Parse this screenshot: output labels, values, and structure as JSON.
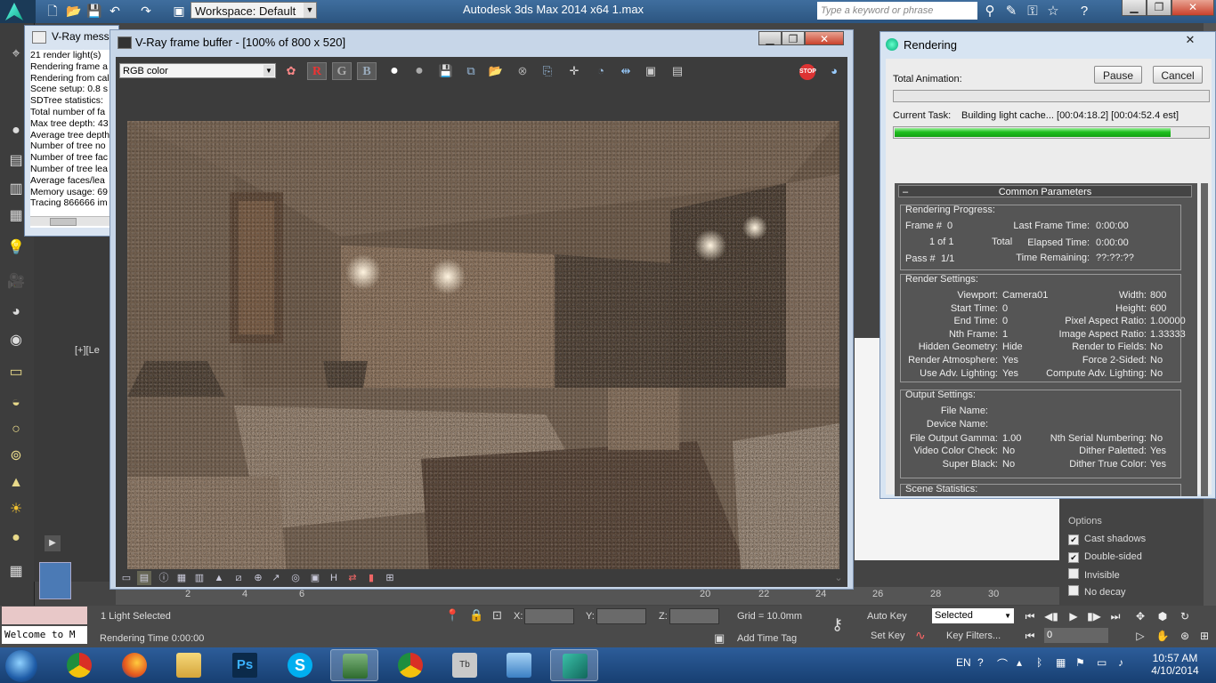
{
  "topbar": {
    "workspace": "Workspace: Default",
    "app_title": "Autodesk 3ds Max  2014 x64      1.max",
    "search_placeholder": "Type a keyword or phrase"
  },
  "vray_messages": {
    "title": "V-Ray messa",
    "lines": [
      "21 render light(s)",
      "Rendering frame a",
      "Rendering from cal",
      "Scene setup: 0.8 s",
      "SDTree statistics:",
      "Total number of fa",
      "Max tree depth: 43",
      "Average tree depth",
      "Number of tree no",
      "Number of tree fac",
      "Number of tree lea",
      "Average faces/lea",
      "Memory usage: 69",
      "Tracing 866666 im"
    ]
  },
  "vfb": {
    "title": "V-Ray frame buffer - [100% of 800 x 520]",
    "channel": "RGB color",
    "r": "R",
    "g": "G",
    "b": "B"
  },
  "rendering": {
    "title": "Rendering",
    "total_animation_label": "Total Animation:",
    "pause": "Pause",
    "cancel": "Cancel",
    "total_progress": 0,
    "current_task_label": "Current Task:",
    "current_task": "Building light cache... [00:04:18.2] [00:04:52.4 est]",
    "task_progress": 0.88,
    "common_params": "Common Parameters",
    "progress": {
      "title": "Rendering Progress:",
      "frame_label": "Frame #",
      "frame": "0",
      "of": "1 of 1",
      "total": "Total",
      "pass_label": "Pass #",
      "pass": "1/1",
      "last_frame_label": "Last Frame Time:",
      "last_frame": "0:00:00",
      "elapsed_label": "Elapsed Time:",
      "elapsed": "0:00:00",
      "remaining_label": "Time Remaining:",
      "remaining": "??:??:??"
    },
    "settings": {
      "title": "Render Settings:",
      "left": [
        [
          "Viewport:",
          "Camera01"
        ],
        [
          "Start Time:",
          "0"
        ],
        [
          "End Time:",
          "0"
        ],
        [
          "Nth Frame:",
          "1"
        ],
        [
          "Hidden Geometry:",
          "Hide"
        ],
        [
          "Render Atmosphere:",
          "Yes"
        ],
        [
          "Use Adv. Lighting:",
          "Yes"
        ]
      ],
      "right": [
        [
          "Width:",
          "800"
        ],
        [
          "Height:",
          "600"
        ],
        [
          "Pixel Aspect Ratio:",
          "1.00000"
        ],
        [
          "Image Aspect Ratio:",
          "1.33333"
        ],
        [
          "Render to Fields:",
          "No"
        ],
        [
          "Force 2-Sided:",
          "No"
        ],
        [
          "Compute Adv. Lighting:",
          "No"
        ]
      ]
    },
    "output": {
      "title": "Output Settings:",
      "file_name_label": "File Name:",
      "device_name_label": "Device Name:",
      "left": [
        [
          "File Output Gamma:",
          "1.00"
        ],
        [
          "Video Color Check:",
          "No"
        ],
        [
          "Super Black:",
          "No"
        ]
      ],
      "right": [
        [
          "Nth Serial Numbering:",
          "No"
        ],
        [
          "Dither Paletted:",
          "Yes"
        ],
        [
          "Dither True Color:",
          "Yes"
        ]
      ]
    },
    "scene_stats": {
      "title": "Scene Statistics:"
    }
  },
  "viewport_label": "[+][Le",
  "options": {
    "title": "Options",
    "items": [
      {
        "label": "Cast shadows",
        "checked": true
      },
      {
        "label": "Double-sided",
        "checked": true
      },
      {
        "label": "Invisible",
        "checked": false
      },
      {
        "label": "No decay",
        "checked": false
      }
    ]
  },
  "timeline": {
    "ticks": [
      "2",
      "4",
      "6",
      "20",
      "22",
      "24",
      "26",
      "28",
      "30"
    ]
  },
  "status": {
    "welcome": "Welcome to M",
    "selected": "1 Light Selected",
    "rendering_time": "Rendering Time  0:00:00",
    "x": "X:",
    "y": "Y:",
    "z": "Z:",
    "grid": "Grid = 10.0mm",
    "add_time_tag": "Add Time Tag",
    "auto_key": "Auto Key",
    "set_key": "Set Key",
    "selected_dd": "Selected",
    "key_filters": "Key Filters...",
    "frame": "0"
  },
  "taskbar": {
    "lang": "EN",
    "time": "10:57 AM",
    "date": "4/10/2014"
  }
}
